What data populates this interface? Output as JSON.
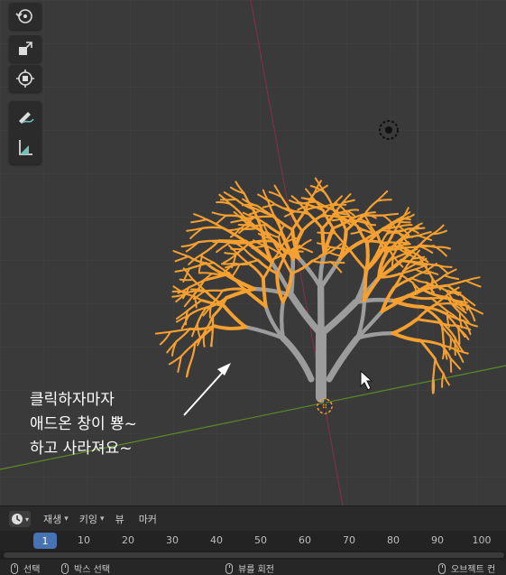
{
  "annotation": {
    "lines": [
      "클릭하자마자",
      "애드온 창이 뿅~",
      "하고 사라져요~"
    ]
  },
  "toolbar": {
    "tools": [
      "rotate-view-icon",
      "scale-icon",
      "transform-icon",
      "annotate-icon",
      "measure-icon"
    ]
  },
  "timeline": {
    "menus": [
      {
        "label": "재생",
        "dropdown": true
      },
      {
        "label": "키잉",
        "dropdown": true
      },
      {
        "label": "뷰",
        "dropdown": false
      },
      {
        "label": "마커",
        "dropdown": false
      }
    ],
    "current_frame": "1",
    "frames": [
      "10",
      "20",
      "30",
      "40",
      "50",
      "60",
      "70",
      "80",
      "90",
      "100"
    ]
  },
  "statusbar": {
    "select": "선택",
    "box_select": "박스 선택",
    "rotate_view": "뷰를 회전",
    "object_context": "오브젝트 컨"
  },
  "colors": {
    "viewport_bg": "#3a3a3a",
    "selection_orange": "#f5a030",
    "trunk_gray": "#9c9c9c",
    "x_axis": "#9a3a4c",
    "y_axis": "#6b9a2c",
    "frame_accent": "#4772b3"
  }
}
